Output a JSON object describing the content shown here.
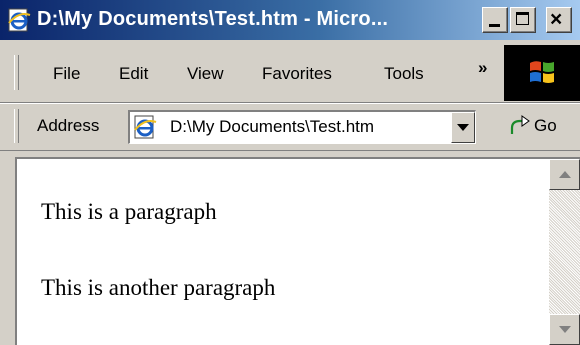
{
  "window": {
    "title": "D:\\My Documents\\Test.htm - Micro...",
    "icons": {
      "app": "ie-page-icon",
      "minimize": "minimize-icon",
      "maximize": "maximize-icon",
      "close": "close-icon"
    },
    "close_glyph": "×"
  },
  "menu": {
    "items": [
      "File",
      "Edit",
      "View",
      "Favorites",
      "Tools"
    ],
    "more_glyph": "»",
    "brand_icon": "windows-logo-icon"
  },
  "address": {
    "label": "Address",
    "value": "D:\\My Documents\\Test.htm",
    "go_label": "Go",
    "icons": {
      "page": "ie-page-icon",
      "dropdown": "chevron-down-icon",
      "go": "go-arrow-icon"
    }
  },
  "content": {
    "paragraphs": [
      "This is a paragraph",
      "This is another paragraph"
    ]
  },
  "colors": {
    "titlebar_start": "#0a246a",
    "titlebar_end": "#a6caf0",
    "chrome": "#d4d0c8",
    "content_bg": "#ffffff"
  }
}
